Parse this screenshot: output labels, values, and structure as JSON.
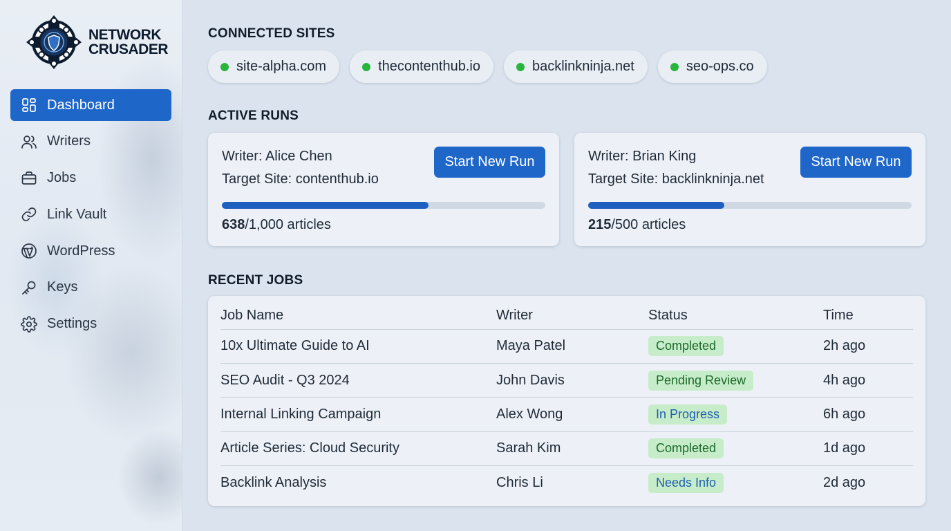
{
  "brand": {
    "line1": "NETWORK",
    "line2": "CRUSADER"
  },
  "sidebar": {
    "items": [
      {
        "label": "Dashboard",
        "icon": "dashboard-icon",
        "active": true
      },
      {
        "label": "Writers",
        "icon": "users-icon",
        "active": false
      },
      {
        "label": "Jobs",
        "icon": "briefcase-icon",
        "active": false
      },
      {
        "label": "Link Vault",
        "icon": "link-icon",
        "active": false
      },
      {
        "label": "WordPress",
        "icon": "wordpress-icon",
        "active": false
      },
      {
        "label": "Keys",
        "icon": "key-icon",
        "active": false
      },
      {
        "label": "Settings",
        "icon": "gear-icon",
        "active": false
      }
    ]
  },
  "connected_sites": {
    "title": "CONNECTED SITES",
    "status_color": "#27b53a",
    "sites": [
      "site-alpha.com",
      "thecontenthub.io",
      "backlinkninja.net",
      "seo-ops.co"
    ]
  },
  "active_runs": {
    "title": "ACTIVE RUNS",
    "runs": [
      {
        "writer": "Writer: Alice Chen",
        "target": "Target Site: contenthub.io",
        "button": "Start New Run",
        "done": "638",
        "total": "/1,000 articles",
        "progress": 0.638
      },
      {
        "writer": "Writer: Brian King",
        "target": "Target Site: backlinkninja.net",
        "button": "Start New Run",
        "done": "215",
        "total": "/500 articles",
        "progress": 0.42
      }
    ]
  },
  "recent_jobs": {
    "title": "RECENT JOBS",
    "headers": [
      "Job Name",
      "Writer",
      "Status",
      "Time"
    ],
    "rows": [
      {
        "name": "10x Ultimate Guide to AI",
        "writer": "Maya Patel",
        "status": "Completed",
        "status_tone": "green",
        "time": "2h ago"
      },
      {
        "name": "SEO Audit - Q3 2024",
        "writer": "John Davis",
        "status": "Pending Review",
        "status_tone": "green",
        "time": "4h ago"
      },
      {
        "name": "Internal Linking Campaign",
        "writer": "Alex Wong",
        "status": "In Progress",
        "status_tone": "blue",
        "time": "6h ago"
      },
      {
        "name": "Article Series: Cloud Security",
        "writer": "Sarah Kim",
        "status": "Completed",
        "status_tone": "green",
        "time": "1d ago"
      },
      {
        "name": "Backlink Analysis",
        "writer": "Chris Li",
        "status": "Needs Info",
        "status_tone": "blue",
        "time": "2d ago"
      }
    ]
  },
  "colors": {
    "accent": "#1f66c9",
    "progress": "#1f5fbf",
    "badge_bg": "#c7ecc9"
  }
}
